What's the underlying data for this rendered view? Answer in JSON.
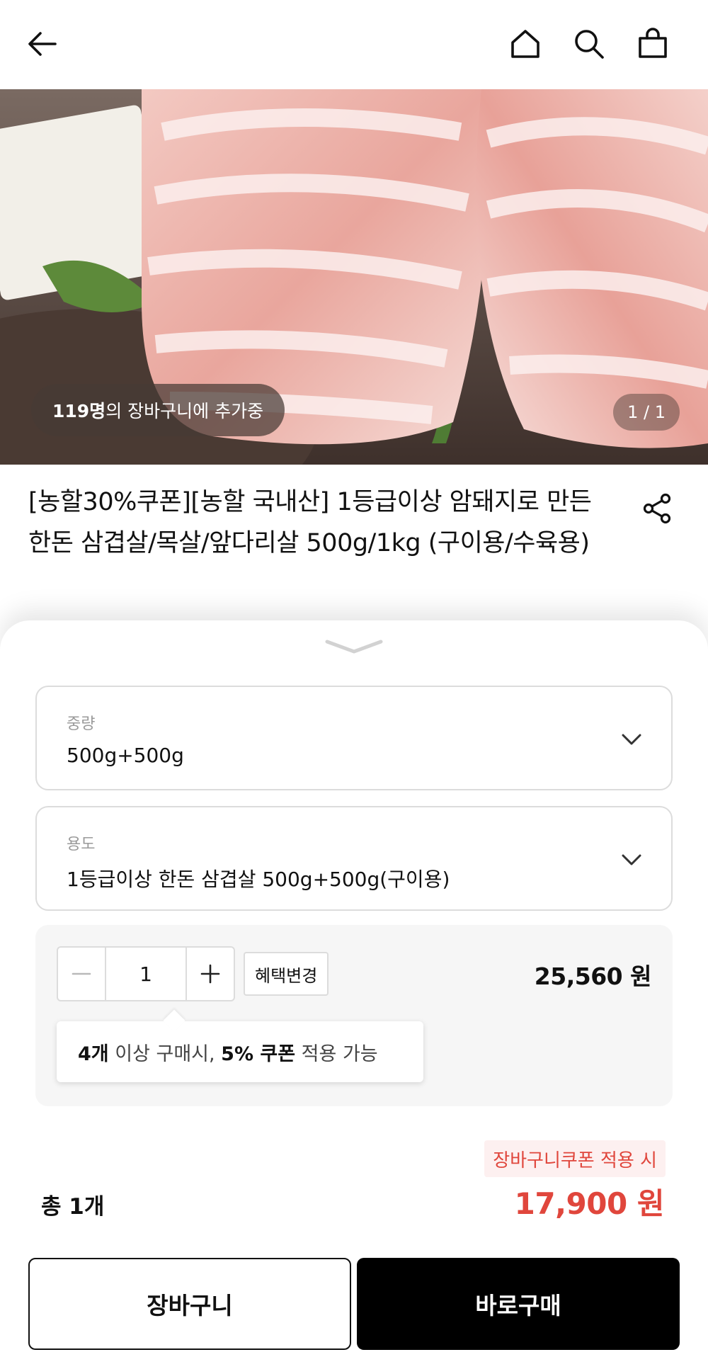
{
  "topbar": {
    "back_icon": "arrow-left-icon",
    "home_icon": "home-icon",
    "search_icon": "search-icon",
    "cart_icon": "shopping-bag-icon"
  },
  "hero": {
    "cart_count_strong": "119명",
    "cart_count_text": "의 장바구니에 추가중",
    "page_indicator": "1 / 1"
  },
  "product": {
    "title": "[농할30%쿠폰][농할 국내산] 1등급이상 암돼지로 만든 한돈 삼겹살/목살/앞다리살 500g/1kg (구이용/수육용)",
    "share_icon": "share-icon"
  },
  "options": {
    "weight_label": "중량",
    "weight_value": "500g+500g",
    "usage_label": "용도",
    "usage_value": "1등급이상 한돈 삼겹살 500g+500g(구이용)"
  },
  "quantity": {
    "value": "1",
    "benefit_button": "혜택변경",
    "unit_price": "25,560 원",
    "tip": {
      "count_strong": "4개",
      "count_text": " 이상 구매시, ",
      "coupon_strong": "5% 쿠폰",
      "coupon_text": " 적용 가능"
    }
  },
  "summary": {
    "coupon_tag": "장바구니쿠폰 적용 시",
    "total_label": "총 1개",
    "total_price": "17,900 원"
  },
  "actions": {
    "cart_button": "장바구니",
    "buy_button": "바로구매"
  },
  "colors": {
    "accent_red": "#e0463c",
    "buy_button_bg": "#000000"
  }
}
